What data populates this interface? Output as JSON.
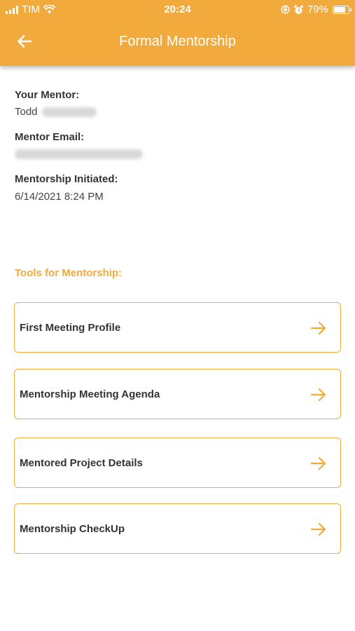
{
  "status_bar": {
    "carrier": "TIM",
    "time": "20:24",
    "battery": "79%",
    "battery_level": 0.79
  },
  "header": {
    "title": "Formal Mentorship"
  },
  "mentor": {
    "mentor_label": "Your Mentor:",
    "mentor_first_name": "Todd",
    "email_label": "Mentor Email:",
    "initiated_label": "Mentorship Initiated:",
    "initiated_value": "6/14/2021 8:24 PM"
  },
  "tools": {
    "heading": "Tools for Mentorship:",
    "items": [
      {
        "label": "First Meeting Profile"
      },
      {
        "label": "Mentorship Meeting Agenda"
      },
      {
        "label": "Mentored Project Details"
      },
      {
        "label": "Mentorship CheckUp"
      }
    ]
  },
  "colors": {
    "accent": "#F2AA3C",
    "text": "#333333",
    "background": "#FFFFFF"
  },
  "icons": {
    "back": "arrow-left-icon",
    "item_arrow": "arrow-right-icon",
    "wifi": "wifi-icon",
    "signal": "signal-icon",
    "lock": "orientation-lock-icon",
    "alarm": "alarm-icon",
    "battery": "battery-icon"
  }
}
